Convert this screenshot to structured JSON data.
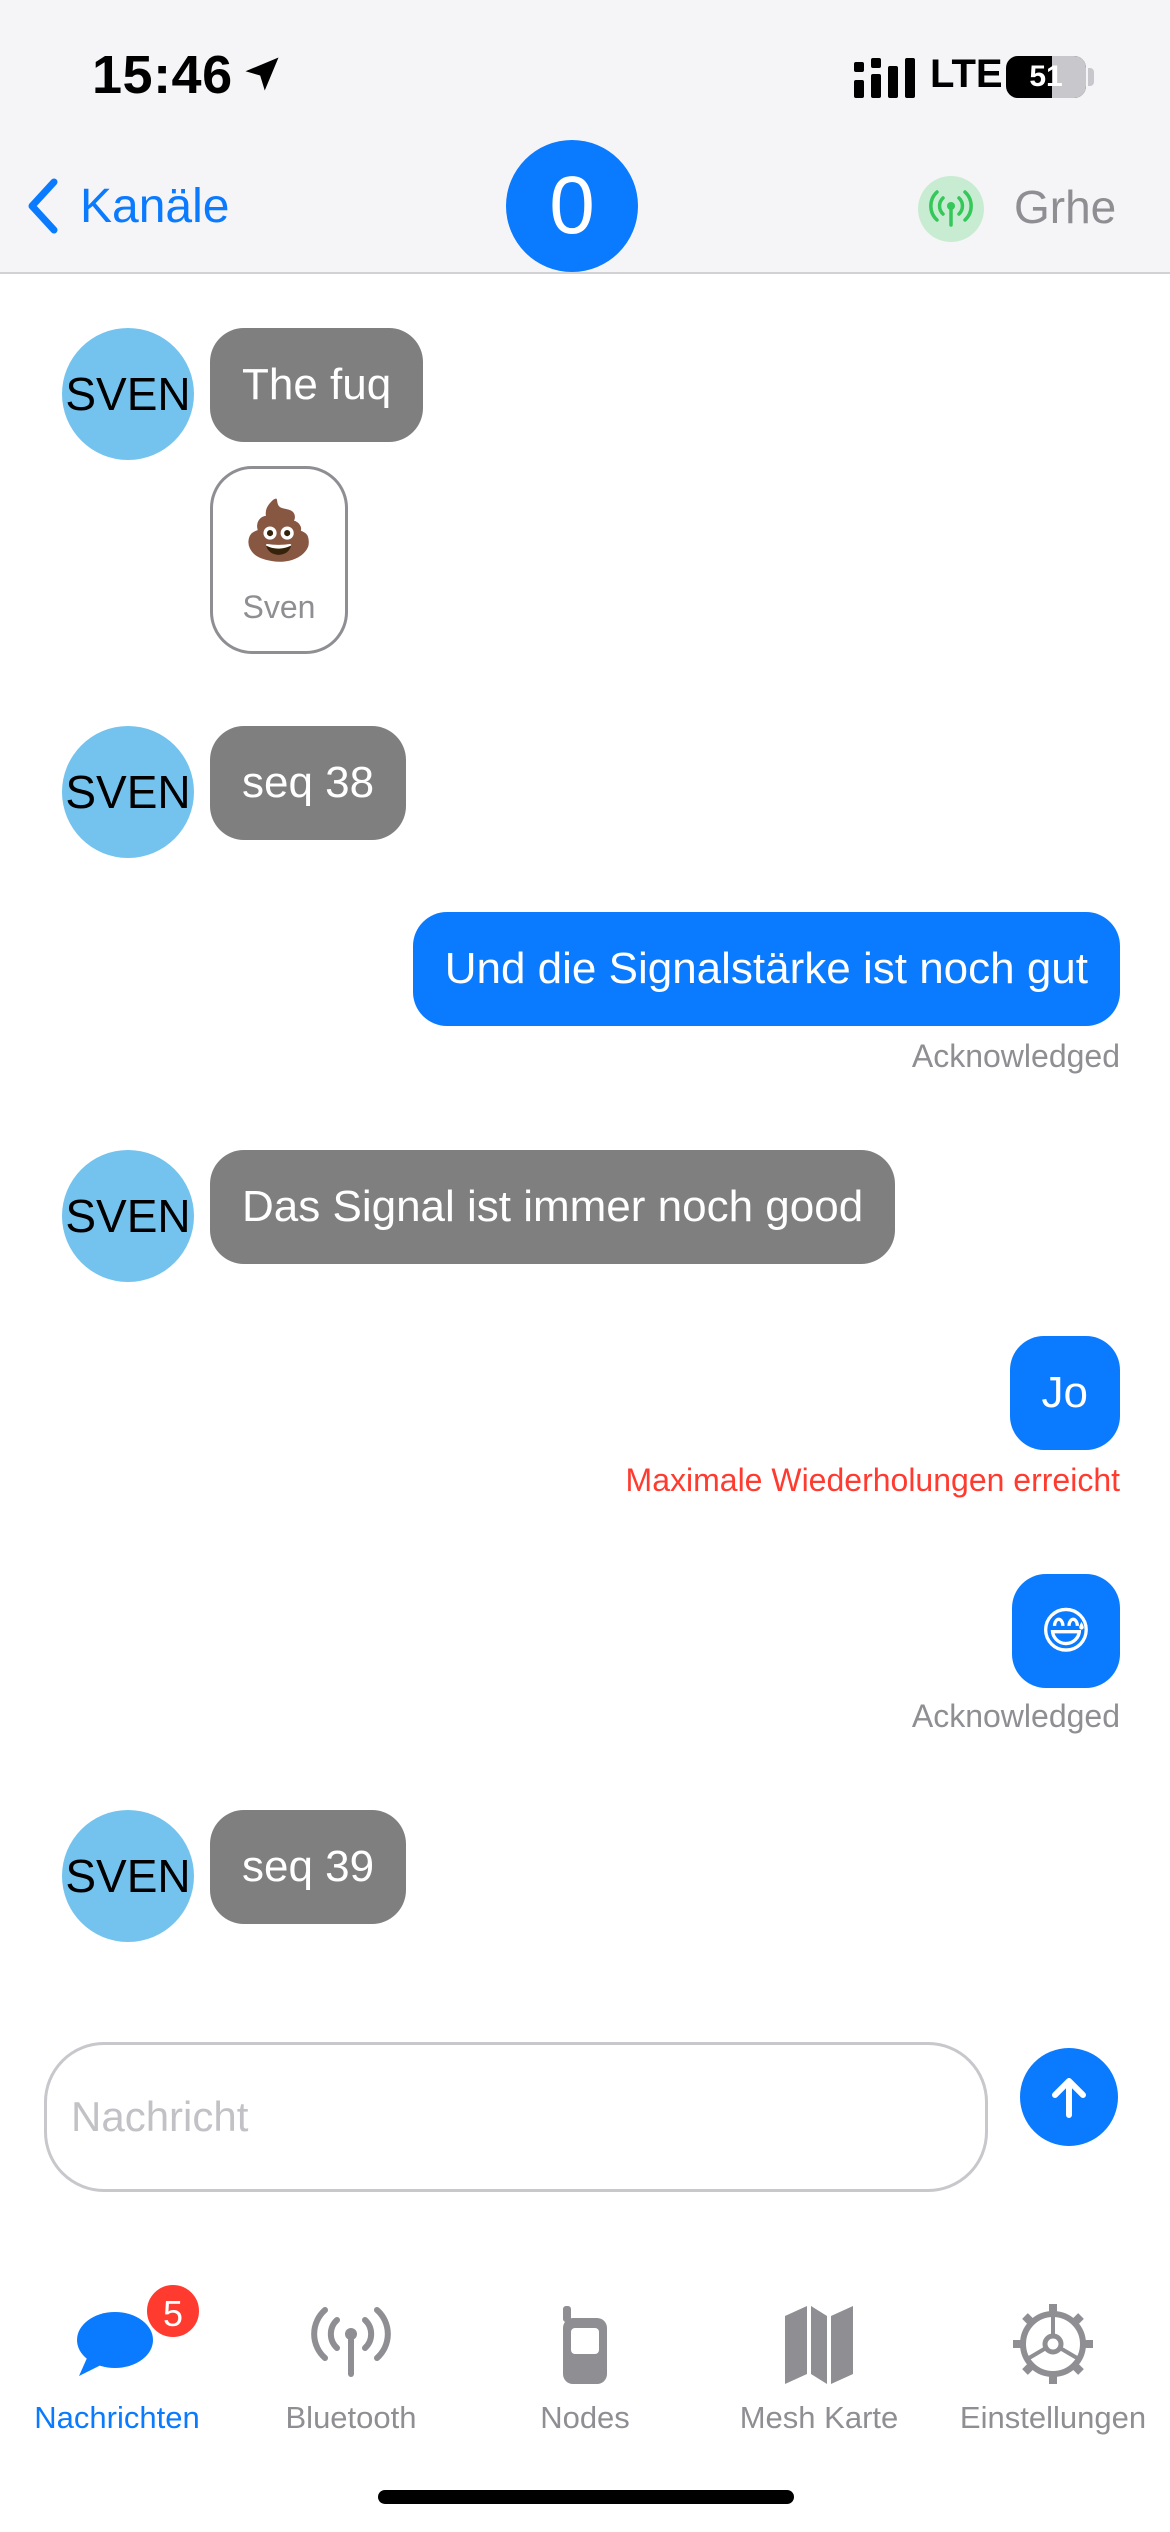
{
  "status_bar": {
    "time": "15:46",
    "network": "LTE",
    "battery": "51"
  },
  "nav": {
    "back_label": "Kanäle",
    "channel_number": "0",
    "connected_node": "Grhe"
  },
  "messages": [
    {
      "sender": "SVEN",
      "text": "The fuq",
      "reaction": {
        "emoji": "💩",
        "name": "Sven"
      }
    },
    {
      "sender": "SVEN",
      "text": "seq 38"
    },
    {
      "text": "Und die Signalstärke ist noch gut",
      "status": "Acknowledged"
    },
    {
      "sender": "SVEN",
      "text": "Das Signal ist immer noch good"
    },
    {
      "text": "Jo",
      "status": "Maximale Wiederholungen erreicht"
    },
    {
      "text": "😅",
      "status": "Acknowledged"
    },
    {
      "sender": "SVEN",
      "text": "seq 39"
    }
  ],
  "composer": {
    "placeholder": "Nachricht"
  },
  "tabs": [
    {
      "label": "Nachrichten",
      "icon": "chat-bubble-icon",
      "badge": "5"
    },
    {
      "label": "Bluetooth",
      "icon": "antenna-icon"
    },
    {
      "label": "Nodes",
      "icon": "handheld-radio-icon"
    },
    {
      "label": "Mesh Karte",
      "icon": "map-icon"
    },
    {
      "label": "Einstellungen",
      "icon": "gear-icon"
    }
  ],
  "colors": {
    "accent": "#0a7aff",
    "incoming_bubble": "#7f7f7f",
    "avatar": "#74c3ee",
    "error": "#ff3b30"
  }
}
